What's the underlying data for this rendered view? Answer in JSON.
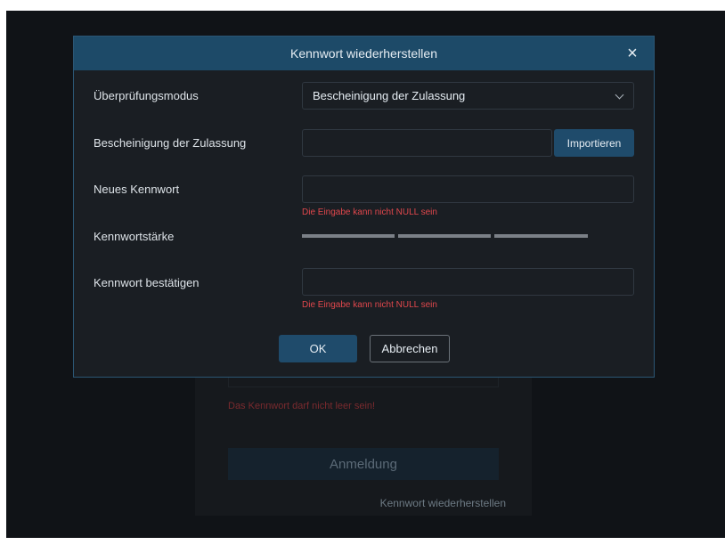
{
  "login": {
    "error_text": "Das Kennwort darf nicht leer sein!",
    "login_button": "Anmeldung",
    "recover_link": "Kennwort wiederherstellen"
  },
  "dialog": {
    "title": "Kennwort wiederherstellen",
    "verification_mode": {
      "label": "Überprüfungsmodus",
      "selected": "Bescheinigung der Zulassung"
    },
    "certificate": {
      "label": "Bescheinigung der Zulassung",
      "value": "",
      "import_button": "Importieren"
    },
    "new_password": {
      "label": "Neues Kennwort",
      "value": "",
      "error": "Die Eingabe kann nicht NULL sein"
    },
    "password_strength": {
      "label": "Kennwortstärke",
      "segments": 3,
      "active_segments": 0
    },
    "confirm_password": {
      "label": "Kennwort bestätigen",
      "value": "",
      "error": "Die Eingabe kann nicht NULL sein"
    },
    "ok_button": "OK",
    "cancel_button": "Abbrechen"
  },
  "colors": {
    "header": "#1d4a68",
    "primary_button": "#1f4b6b",
    "error": "#e0474c",
    "background": "#101317"
  }
}
